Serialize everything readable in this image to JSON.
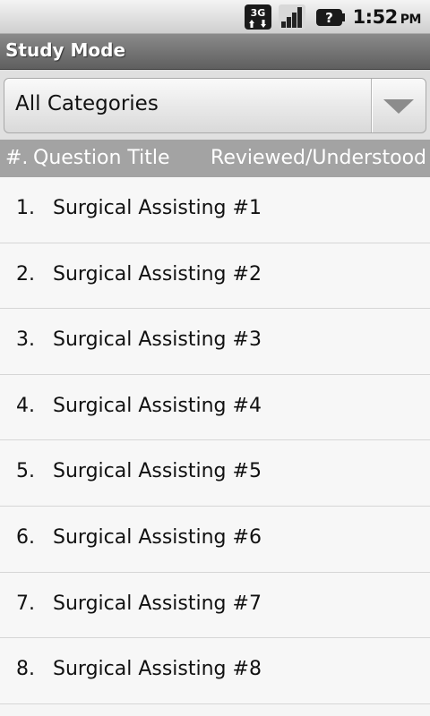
{
  "statusbar": {
    "network_label": "3G",
    "time": "1:52",
    "ampm": "PM",
    "icons": [
      "3g-data-icon",
      "signal-strength-icon",
      "battery-unknown-icon"
    ]
  },
  "app": {
    "title": "Study Mode"
  },
  "category_spinner": {
    "selected": "All Categories"
  },
  "columns": {
    "number": "#.",
    "title": "Question Title",
    "status": "Reviewed/Understood"
  },
  "questions": [
    {
      "number": "1.",
      "title": "Surgical Assisting #1"
    },
    {
      "number": "2.",
      "title": "Surgical Assisting #2"
    },
    {
      "number": "3.",
      "title": "Surgical Assisting #3"
    },
    {
      "number": "4.",
      "title": "Surgical Assisting #4"
    },
    {
      "number": "5.",
      "title": "Surgical Assisting #5"
    },
    {
      "number": "6.",
      "title": "Surgical Assisting #6"
    },
    {
      "number": "7.",
      "title": "Surgical Assisting #7"
    },
    {
      "number": "8.",
      "title": "Surgical Assisting #8"
    }
  ]
}
